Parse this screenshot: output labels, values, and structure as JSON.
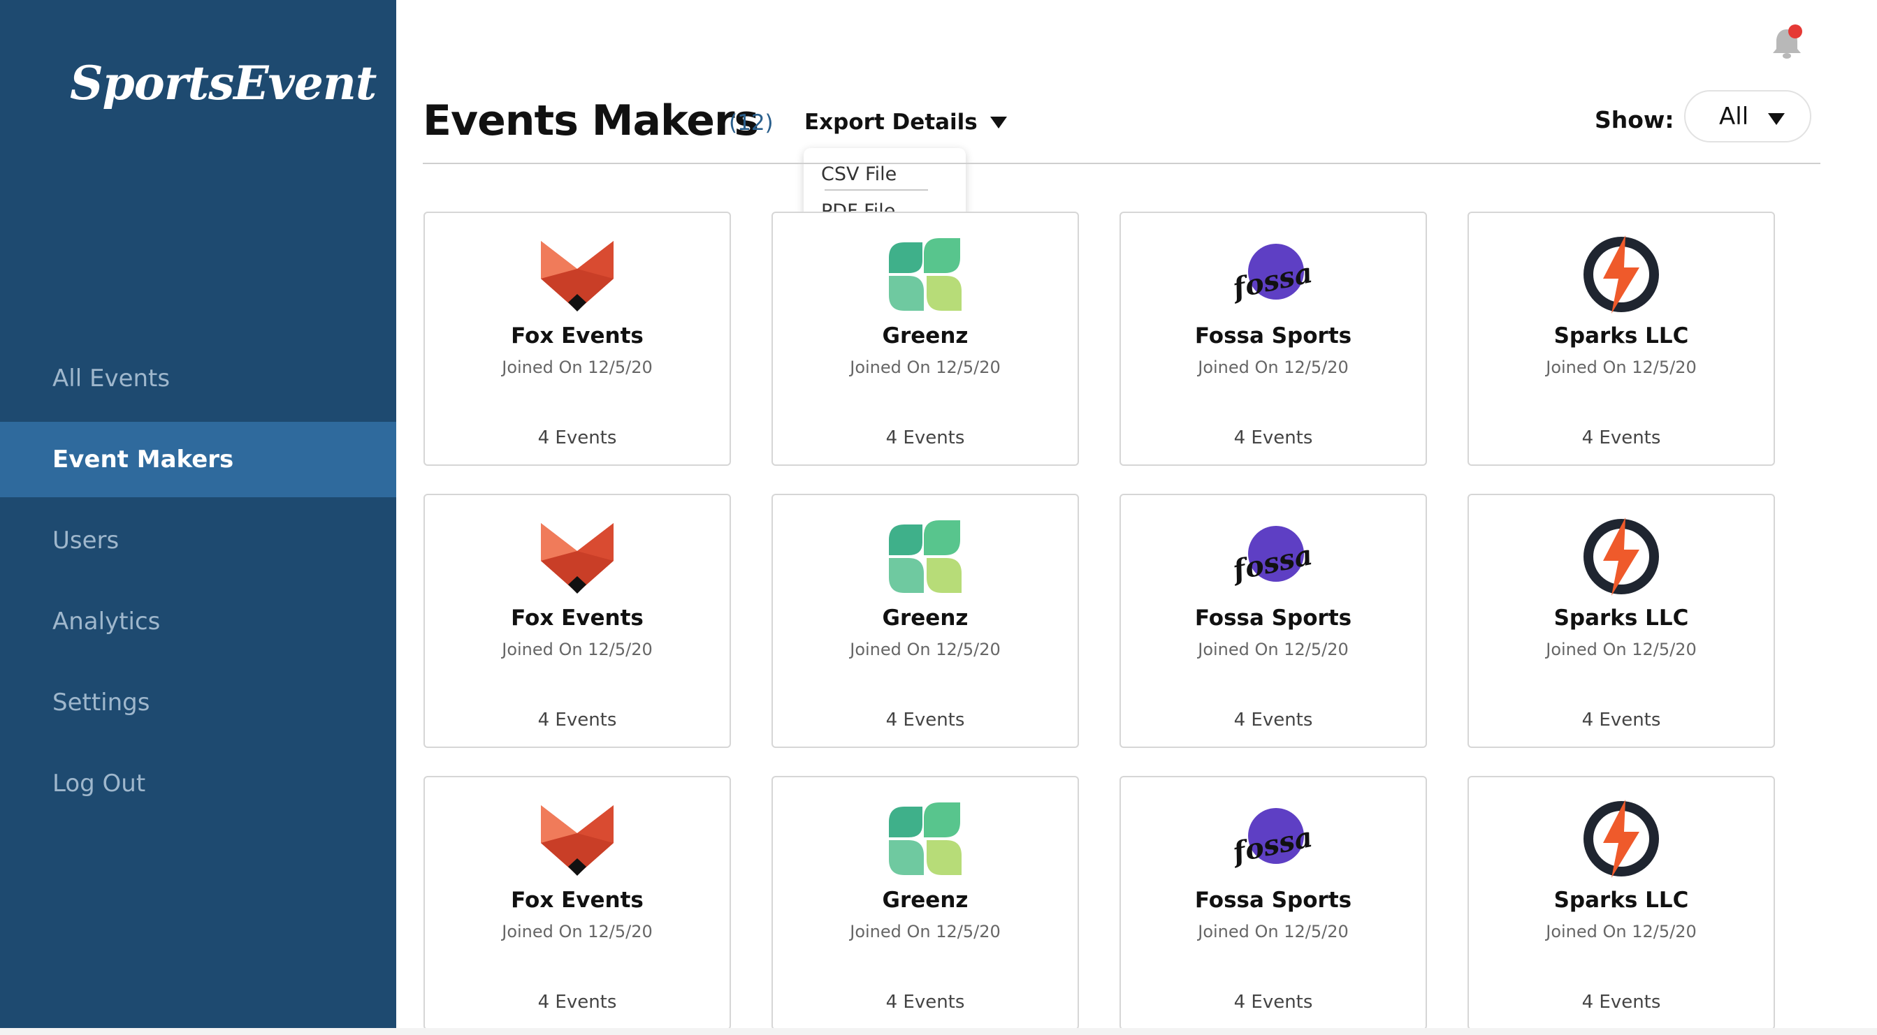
{
  "app": {
    "logo_text": "SportsEvent"
  },
  "sidebar": {
    "items": [
      {
        "label": "All Events",
        "active": false
      },
      {
        "label": "Event Makers",
        "active": true
      },
      {
        "label": "Users",
        "active": false
      },
      {
        "label": "Analytics",
        "active": false
      },
      {
        "label": "Settings",
        "active": false
      },
      {
        "label": "Log Out",
        "active": false
      }
    ]
  },
  "header": {
    "title": "Events Makers",
    "count": "(12)",
    "export_label": "Export Details",
    "export_options": [
      "CSV File",
      "PDF File"
    ],
    "show_label": "Show:",
    "show_value": "All"
  },
  "colors": {
    "sidebar_bg": "#1e4a70",
    "sidebar_active": "#2f6a9d",
    "count_text": "#2a5f8c",
    "notification_dot": "#e53935"
  },
  "icons": {
    "notification": "bell-icon",
    "dropdown": "caret-down-icon"
  },
  "cards": [
    {
      "name": "Fox Events",
      "joined": "Joined On 12/5/20",
      "events": "4 Events",
      "logo": "fox-logo"
    },
    {
      "name": "Greenz",
      "joined": "Joined On 12/5/20",
      "events": "4 Events",
      "logo": "clover-logo"
    },
    {
      "name": "Fossa Sports",
      "joined": "Joined On 12/5/20",
      "events": "4 Events",
      "logo": "fossa-logo",
      "logo_text": "fossa"
    },
    {
      "name": "Sparks LLC",
      "joined": "Joined On 12/5/20",
      "events": "4 Events",
      "logo": "bolt-logo"
    },
    {
      "name": "Fox Events",
      "joined": "Joined On 12/5/20",
      "events": "4 Events",
      "logo": "fox-logo"
    },
    {
      "name": "Greenz",
      "joined": "Joined On 12/5/20",
      "events": "4 Events",
      "logo": "clover-logo"
    },
    {
      "name": "Fossa Sports",
      "joined": "Joined On 12/5/20",
      "events": "4 Events",
      "logo": "fossa-logo",
      "logo_text": "fossa"
    },
    {
      "name": "Sparks LLC",
      "joined": "Joined On 12/5/20",
      "events": "4 Events",
      "logo": "bolt-logo"
    },
    {
      "name": "Fox Events",
      "joined": "Joined On 12/5/20",
      "events": "4 Events",
      "logo": "fox-logo"
    },
    {
      "name": "Greenz",
      "joined": "Joined On 12/5/20",
      "events": "4 Events",
      "logo": "clover-logo"
    },
    {
      "name": "Fossa Sports",
      "joined": "Joined On 12/5/20",
      "events": "4 Events",
      "logo": "fossa-logo",
      "logo_text": "fossa"
    },
    {
      "name": "Sparks LLC",
      "joined": "Joined On 12/5/20",
      "events": "4 Events",
      "logo": "bolt-logo"
    }
  ]
}
